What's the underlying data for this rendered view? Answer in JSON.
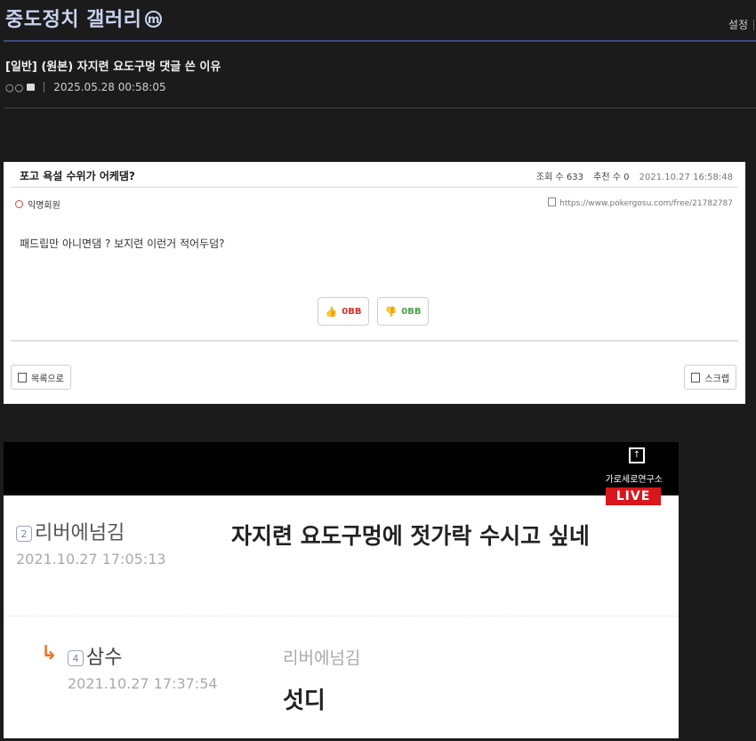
{
  "header": {
    "gallery_title": "중도정치 갤러리",
    "minor_badge": "ⓜ",
    "settings_label": "설정"
  },
  "post": {
    "title": "[일반] (원본) 자지련 요도구멍 댓글 쓴 이유",
    "author": "ㅇㅇ",
    "datetime": "2025.05.28 00:58:05"
  },
  "embed1": {
    "title": "포고 욕설 수위가 어케댐?",
    "views": "조회 수 633",
    "recommend": "추천 수 0",
    "date": "2021.10.27 16:58:48",
    "author": "익명회원",
    "url": "https://www.pokergosu.com/free/21782787",
    "body": "패드립만 아니면댐 ? 보지련 이런거 적어두덤?",
    "upvote": "0BB",
    "downvote": "0BB",
    "list_button": "목록으로",
    "scrap_button": "스크랩"
  },
  "embed2": {
    "logo_text": "가로세로연구소",
    "live_badge": "LIVE",
    "comment1": {
      "level": "2",
      "name": "리버에넘김",
      "date": "2021.10.27 17:05:13",
      "text": "자지련 요도구멍에 젓가락 수시고 싶네"
    },
    "comment2": {
      "level": "4",
      "name": "삼수",
      "date": "2021.10.27 17:37:54",
      "reply_to": "리버에넘김",
      "text": "섯디"
    }
  }
}
